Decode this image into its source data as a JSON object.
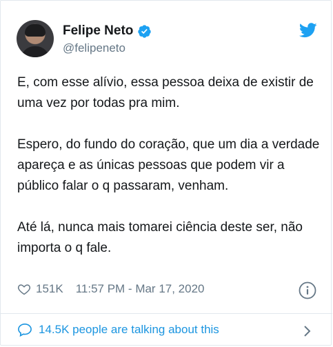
{
  "author": {
    "name": "Felipe Neto",
    "handle": "@felipeneto",
    "verified": true
  },
  "tweet": {
    "paragraphs": [
      "E, com esse alívio, essa pessoa deixa de existir de uma vez por todas pra mim.",
      "Espero, do fundo do coração, que um dia a verdade apareça e as únicas pessoas que podem vir a público falar o q passaram, venham.",
      "Até lá, nunca mais tomarei ciência deste ser, não importa o q fale."
    ]
  },
  "meta": {
    "likes": "151K",
    "timestamp": "11:57 PM - Mar 17, 2020"
  },
  "footer": {
    "talking_text": "14.5K people are talking about this"
  },
  "colors": {
    "twitter_blue": "#1da1f2",
    "link_blue": "#1b95e0",
    "secondary_text": "#657786"
  },
  "icons": [
    "verified-badge-icon",
    "twitter-bird-icon",
    "heart-icon",
    "info-icon",
    "speech-bubble-icon",
    "chevron-right-icon"
  ]
}
